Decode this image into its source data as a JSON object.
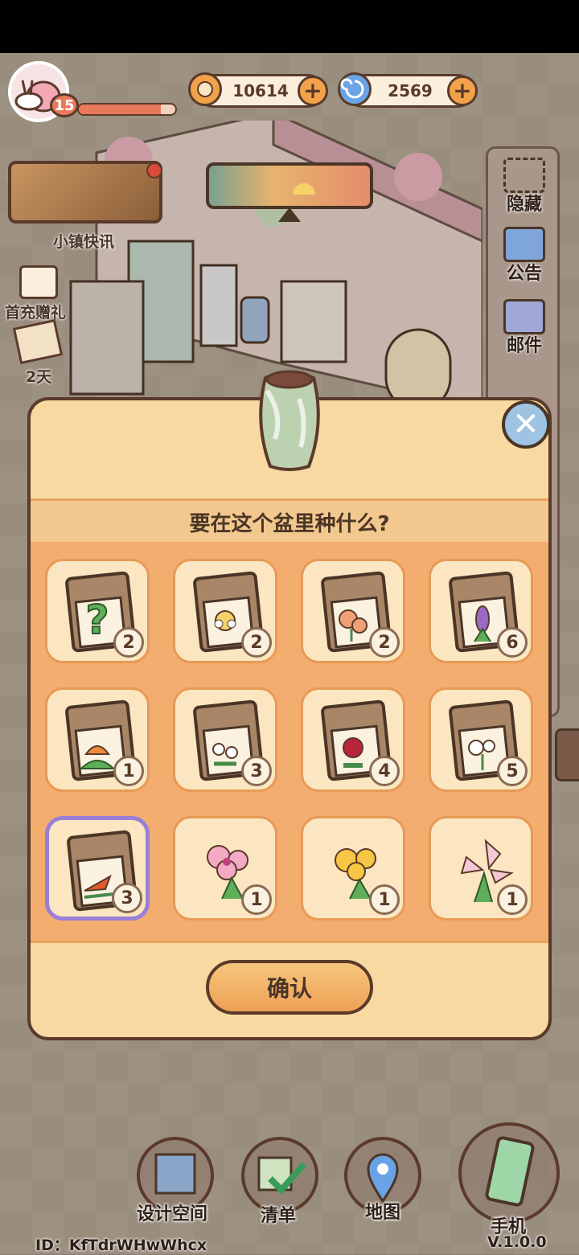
{
  "hud": {
    "level": "15",
    "level_progress": 0.85,
    "coins": "10614",
    "gems": "2569"
  },
  "left_menu": {
    "news_label": "小镇快讯",
    "first_charge_label": "首充赠礼",
    "days_label": "2天"
  },
  "right_menu": {
    "hide_label": "隐藏",
    "notice_label": "公告",
    "mail_label": "邮件"
  },
  "dialog": {
    "title": "要在这个盆里种什么?",
    "confirm_label": "确认",
    "items": [
      {
        "kind": "seed-mystery",
        "count": "2"
      },
      {
        "kind": "seed-yellow-flower",
        "count": "2"
      },
      {
        "kind": "seed-orange-rose",
        "count": "2"
      },
      {
        "kind": "seed-hyacinth",
        "count": "6"
      },
      {
        "kind": "seed-orange-tulip",
        "count": "1"
      },
      {
        "kind": "seed-white-flower",
        "count": "3"
      },
      {
        "kind": "seed-red-rose",
        "count": "4"
      },
      {
        "kind": "seed-white-hydrangea",
        "count": "5"
      },
      {
        "kind": "seed-bird-of-paradise",
        "count": "3",
        "selected": true
      },
      {
        "kind": "pink-flower",
        "count": "1"
      },
      {
        "kind": "yellow-flower",
        "count": "1"
      },
      {
        "kind": "pink-lily",
        "count": "1"
      }
    ]
  },
  "bottom_nav": {
    "design_label": "设计空间",
    "list_label": "清单",
    "map_label": "地图",
    "phone_label": "手机"
  },
  "footer": {
    "id_text": "ID：KfTdrWHwWhcx",
    "version": "V.1.0.0"
  },
  "colors": {
    "panel": "#f8d9a2",
    "grid": "#f2ad6f",
    "outline": "#5a3a2a",
    "selected": "#9a7fd6"
  }
}
